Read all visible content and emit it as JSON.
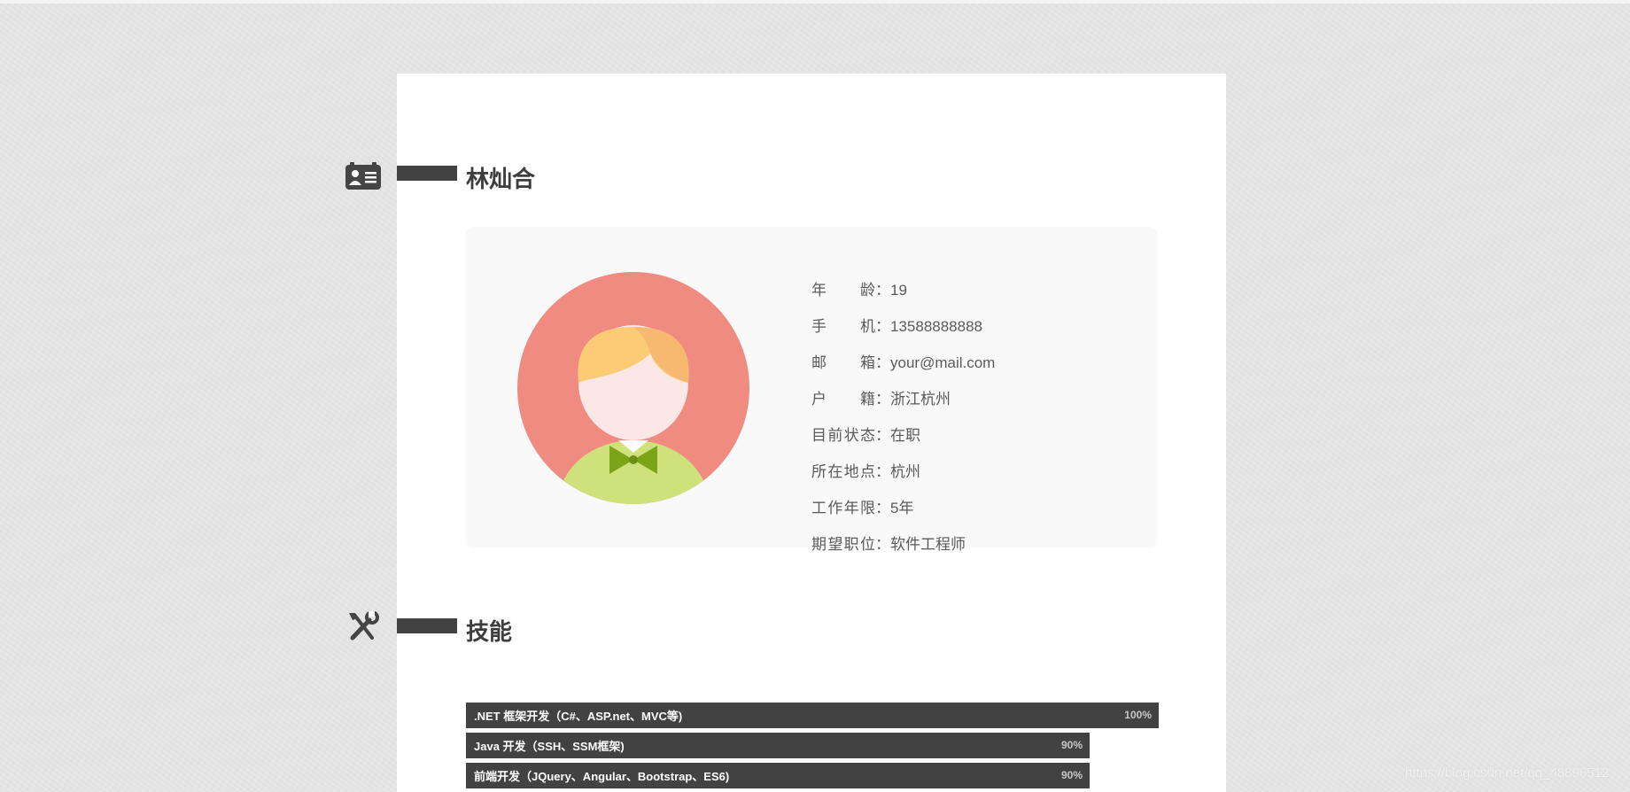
{
  "profile": {
    "name": "林灿合",
    "fields": [
      {
        "label": "年龄",
        "colon": "：",
        "value": "19"
      },
      {
        "label": "手机",
        "colon": "：",
        "value": "13588888888"
      },
      {
        "label": "邮箱",
        "colon": "：",
        "value": "your@mail.com"
      },
      {
        "label": "户籍",
        "colon": "：",
        "value": "浙江杭州"
      },
      {
        "label": "目前状态",
        "colon": "：",
        "value": "在职"
      },
      {
        "label": "所在地点",
        "colon": "：",
        "value": "杭州"
      },
      {
        "label": "工作年限",
        "colon": "：",
        "value": "5年"
      },
      {
        "label": "期望职位",
        "colon": "：",
        "value": "软件工程师"
      }
    ]
  },
  "skills": {
    "title": "技能",
    "items": [
      {
        "name": ".NET 框架开发（C#、ASP.net、MVC等)",
        "percent": "100%",
        "level": 1.0
      },
      {
        "name": "Java 开发（SSH、SSM框架)",
        "percent": "90%",
        "level": 0.9
      },
      {
        "name": "前端开发（JQuery、Angular、Bootstrap、ES6)",
        "percent": "90%",
        "level": 0.9
      }
    ]
  },
  "icons": {
    "profile_section": "id-card-icon",
    "skills_section": "wrench-screwdriver-icon",
    "avatar": "avatar-boy-illustration"
  },
  "colors": {
    "background": "#e6e6e6",
    "page": "#ffffff",
    "accent_dark": "#424242",
    "card": "#f9f9f9",
    "avatar_bg": "#ef8b80",
    "hair": "#fccb76",
    "shirt": "#cfe17a",
    "bowtie": "#7ba418"
  },
  "watermark": "https://blog.csdn.net/qq_48896512"
}
